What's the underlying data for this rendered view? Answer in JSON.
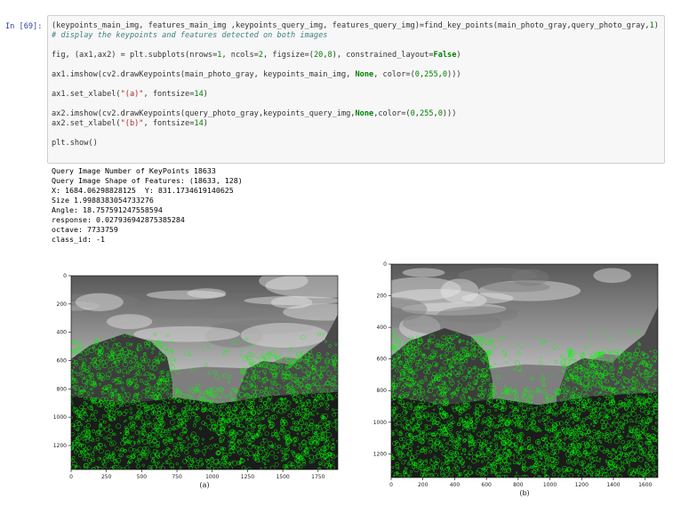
{
  "prompt": "In [69]:",
  "code": {
    "line1": {
      "a": "(keypoints_main_img, features_main_img ,keypoints_query_img, features_query_img)=find_key_points(main_photo_gray,query_photo_gray,",
      "b": "1",
      "c": ")"
    },
    "line2": "# display the keypoints and features detected on both images",
    "line3": {
      "a": "fig, (ax1,ax2) = plt.subplots(nrows=",
      "b": "1",
      "c": ", ncols=",
      "d": "2",
      "e": ", figsize=(",
      "f": "20",
      "g": ",",
      "h": "8",
      "i": "), constrained_layout=",
      "j": "False",
      "k": ")"
    },
    "line4": {
      "a": "ax1.imshow(cv2.drawKeypoints(main_photo_gray, keypoints_main_img, ",
      "b": "None",
      "c": ", color=(",
      "d": "0",
      "e": ",",
      "f": "255",
      "g": ",",
      "h": "0",
      "i": ")))"
    },
    "line5": {
      "a": "ax1.set_xlabel(",
      "b": "\"(a)\"",
      "c": ", fontsize=",
      "d": "14",
      "e": ")"
    },
    "line6": {
      "a": "ax2.imshow(cv2.drawKeypoints(query_photo_gray,keypoints_query_img,",
      "b": "None",
      "c": ",color=(",
      "d": "0",
      "e": ",",
      "f": "255",
      "g": ",",
      "h": "0",
      "i": ")))"
    },
    "line7": {
      "a": "ax2.set_xlabel(",
      "b": "\"(b)\"",
      "c": ", fontsize=",
      "d": "14",
      "e": ")"
    },
    "line8": "plt.show()"
  },
  "output": [
    "Query Image Number of KeyPoints 18633",
    "Query Image Shape of Features: (18633, 128)",
    "X: 1684.06298828125  Y: 831.1734619140625",
    "Size 1.9988383054733276",
    "Angle: 18.757591247558594",
    "response: 0.027936942875385284",
    "octave: 7733759",
    "class_id: -1"
  ],
  "plots": {
    "a": {
      "xlabel": "(a)",
      "xticks": [
        "0",
        "250",
        "500",
        "750",
        "1000",
        "1250",
        "1500",
        "1750"
      ],
      "yticks": [
        "0",
        "200",
        "400",
        "600",
        "800",
        "1000",
        "1200"
      ],
      "keypoint_color": "#00ff00"
    },
    "b": {
      "xlabel": "(b)",
      "xticks": [
        "0",
        "200",
        "400",
        "600",
        "800",
        "1000",
        "1200",
        "1400",
        "1600"
      ],
      "yticks": [
        "0",
        "200",
        "400",
        "600",
        "800",
        "1000",
        "1200"
      ],
      "keypoint_color": "#00ff00"
    }
  }
}
